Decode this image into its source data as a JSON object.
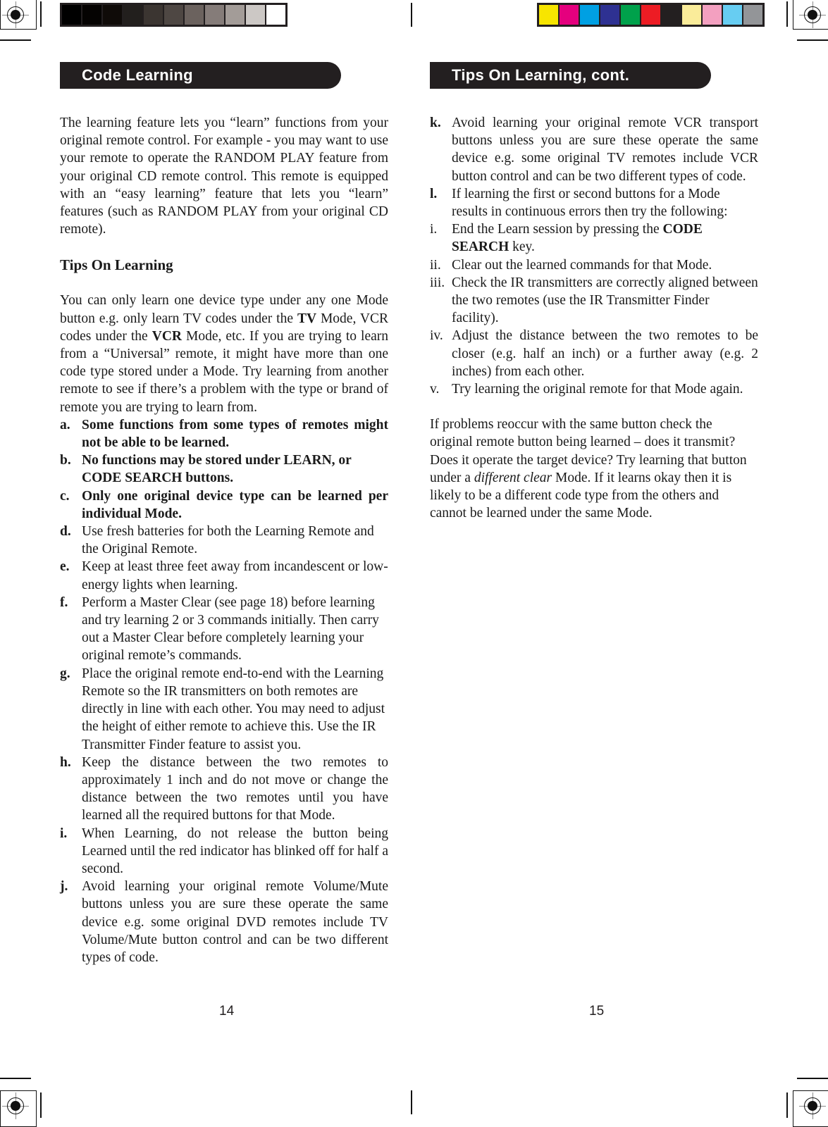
{
  "document": {
    "type": "scanned-manual-spread",
    "ink_color": "#231f20"
  },
  "grayscale_bar": {
    "name": "grayscale-step-wedge",
    "patches": [
      "#000000",
      "#050302",
      "#0f0b08",
      "#221f1d",
      "#3b3531",
      "#4e4743",
      "#6b625e",
      "#857c79",
      "#a39c98",
      "#ccc8c5",
      "#ffffff"
    ]
  },
  "color_bar": {
    "name": "color-control-bar",
    "patches": [
      "#f7e500",
      "#e5007e",
      "#00a0e3",
      "#2e3192",
      "#00a14b",
      "#ed1c24",
      "#231f20",
      "#faec9a",
      "#f3a0c0",
      "#67cdf2",
      "#939598"
    ]
  },
  "left_page": {
    "header": "Code Learning",
    "intro": "The learning feature lets you “learn” functions from your original remote control. For example - you may want to use your remote to operate the RANDOM PLAY feature from your original CD remote control. This remote is equipped with an “easy learning” feature that lets you “learn” features (such as RANDOM PLAY from your original CD remote).",
    "subhead": "Tips On Learning",
    "paragraph_lead_1": "You can only learn one device type under any one Mode button e.g. only learn TV codes under the ",
    "paragraph_kw_1": "TV",
    "paragraph_mid_1": " Mode, VCR codes under the ",
    "paragraph_kw_2": "VCR",
    "paragraph_end_1": " Mode, etc. If you are trying to learn from a “Universal” remote, it might have more than one code type stored under a Mode. Try learning from another remote to see if there’s a problem with the type or brand of remote you are trying to learn from.",
    "items": [
      {
        "marker": "a.",
        "text": "Some functions from some types of remotes might not be able to be learned.",
        "bold": true
      },
      {
        "marker": "b.",
        "text": "No functions may be stored under LEARN, or CODE SEARCH buttons.",
        "bold": true
      },
      {
        "marker": "c.",
        "text": "Only one original device type can be learned per individual Mode.",
        "bold": true
      },
      {
        "marker": "d.",
        "text": "Use fresh batteries for both the Learning Remote and the Original Remote.",
        "bold": false
      },
      {
        "marker": "e.",
        "text": "Keep at least three feet away from incandescent or low-energy lights when learning.",
        "bold": false
      },
      {
        "marker": "f.",
        "text": "Perform a Master Clear (see page 18) before learning and try learning 2 or 3 commands initially. Then carry out a Master Clear before completely learning your original remote’s commands.",
        "bold": false
      },
      {
        "marker": "g.",
        "text": "Place the original remote end-to-end with the Learning Remote so the IR transmitters on both remotes are directly in line with each other.  You may need to adjust the height of either remote to achieve this. Use the IR Transmitter Finder feature to assist you.",
        "bold": false
      },
      {
        "marker": "h.",
        "text": "Keep the distance between the two remotes to approximately 1 inch and do not move or change the distance between the two remotes until you have learned all the required buttons for that Mode.",
        "bold": false
      },
      {
        "marker": "i.",
        "text": "When Learning, do not release the button being Learned until the red indicator has blinked off for half a second.",
        "bold": false
      },
      {
        "marker": "j.",
        "text": "Avoid learning your original remote Volume/Mute buttons unless you are sure these operate the same device e.g. some original DVD remotes include TV Volume/Mute button control and can be two different types of code.",
        "bold": false
      }
    ],
    "page_number": "14"
  },
  "right_page": {
    "header": "Tips On Learning, cont.",
    "items": [
      {
        "marker": "k.",
        "text": "Avoid learning your original remote VCR transport buttons unless you are sure these operate the same device e.g. some original TV remotes include VCR button control and can be two different types of code.",
        "bold": false
      },
      {
        "marker": "l.",
        "text": "If learning the first or second buttons for a Mode results in continuous errors then try the following:",
        "bold": false
      }
    ],
    "roman_items": [
      {
        "marker": "i.",
        "lead": "End the Learn session by pressing the ",
        "keyword": "CODE SEARCH",
        "tail": " key."
      },
      {
        "marker": "ii.",
        "lead": "Clear out the learned commands for that Mode.",
        "keyword": "",
        "tail": ""
      },
      {
        "marker": "iii.",
        "lead": "Check the IR transmitters are correctly aligned between the two remotes (use the IR Transmitter Finder facility).",
        "keyword": "",
        "tail": ""
      },
      {
        "marker": "iv.",
        "lead": "Adjust the distance between the two remotes to be closer (e.g. half an inch) or a further away (e.g. 2 inches) from each other.",
        "keyword": "",
        "tail": ""
      },
      {
        "marker": "v.",
        "lead": "Try learning the original remote for that Mode again.",
        "keyword": "",
        "tail": ""
      }
    ],
    "closing_lead": "If problems reoccur with the same button check the original remote button being learned – does it transmit?  Does it operate the target device?  Try learning that button under a ",
    "closing_em": "different clear",
    "closing_tail": " Mode.  If it learns okay then it is likely to be a different code type from the others and cannot be learned under the same Mode.",
    "page_number": "15"
  }
}
